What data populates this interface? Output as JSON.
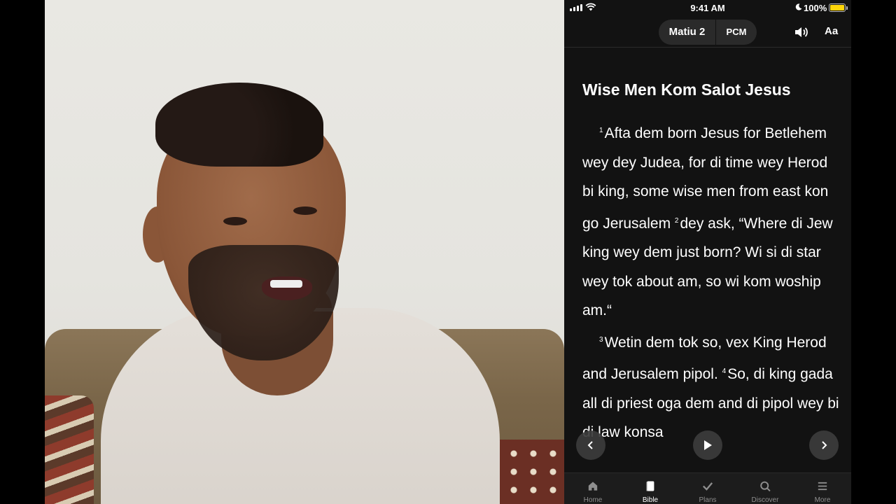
{
  "status_bar": {
    "time": "9:41 AM",
    "battery": "100%"
  },
  "toolbar": {
    "book_chapter": "Matiu 2",
    "version": "PCM",
    "font_button": "Aa"
  },
  "reader": {
    "heading": "Wise Men Kom Salot Jesus",
    "paragraphs": [
      {
        "v1": "1",
        "t1": "Afta dem born Jesus for Betlehem wey dey Judea, for di time wey Herod bi king, some wise men from east kon go Jerusalem",
        "v2": "2",
        "t2": "dey ask, “Where di Jew king wey dem just born? Wi si di star wey tok about am, so wi kom woship am.“"
      },
      {
        "v1": "3",
        "t1": "Wetin dem tok so, vex King Herod and Jerusalem pipol.",
        "v2": "4",
        "t2": "So, di king gada all di priest oga dem and di pipol wey bi di law konsa"
      }
    ]
  },
  "tabs": [
    {
      "label": "Home",
      "icon": "home-icon"
    },
    {
      "label": "Bible",
      "icon": "book-icon"
    },
    {
      "label": "Plans",
      "icon": "check-icon"
    },
    {
      "label": "Discover",
      "icon": "search-icon"
    },
    {
      "label": "More",
      "icon": "menu-icon"
    }
  ],
  "colors": {
    "app_bg": "#121212",
    "battery": "#ffd60a"
  }
}
